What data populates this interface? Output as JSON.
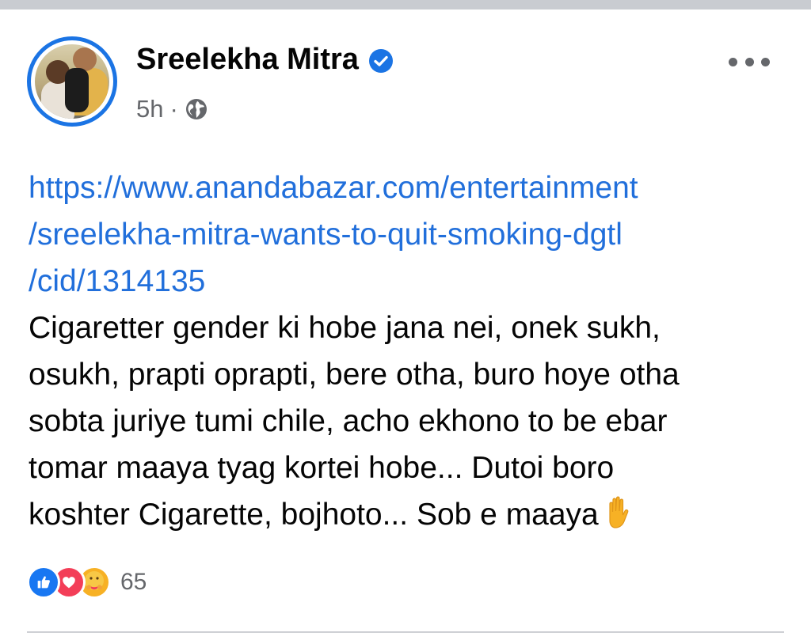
{
  "post": {
    "author": "Sreelekha Mitra",
    "verified": true,
    "time": "5h",
    "separator": "·",
    "audience_icon": "globe-icon",
    "link_lines": [
      "https://www.anandabazar.com/entertainment",
      "/sreelekha-mitra-wants-to-quit-smoking-dgtl",
      "/cid/1314135"
    ],
    "text_lines": [
      "Cigaretter gender ki hobe jana nei, onek sukh,",
      "osukh, prapti oprapti, bere otha, buro hoye otha",
      "sobta juriye tumi chile, acho ekhono to be ebar",
      "tomar maaya tyag kortei hobe... Dutoi boro",
      "koshter Cigarette, bojhoto... Sob e maaya"
    ],
    "trailing_emoji": "raised-hand-icon",
    "reactions": {
      "icons": [
        "like-icon",
        "love-icon",
        "care-icon"
      ],
      "count": "65"
    }
  },
  "colors": {
    "link": "#216fdb",
    "verified": "#1b74e4",
    "secondary_text": "#65676b"
  }
}
